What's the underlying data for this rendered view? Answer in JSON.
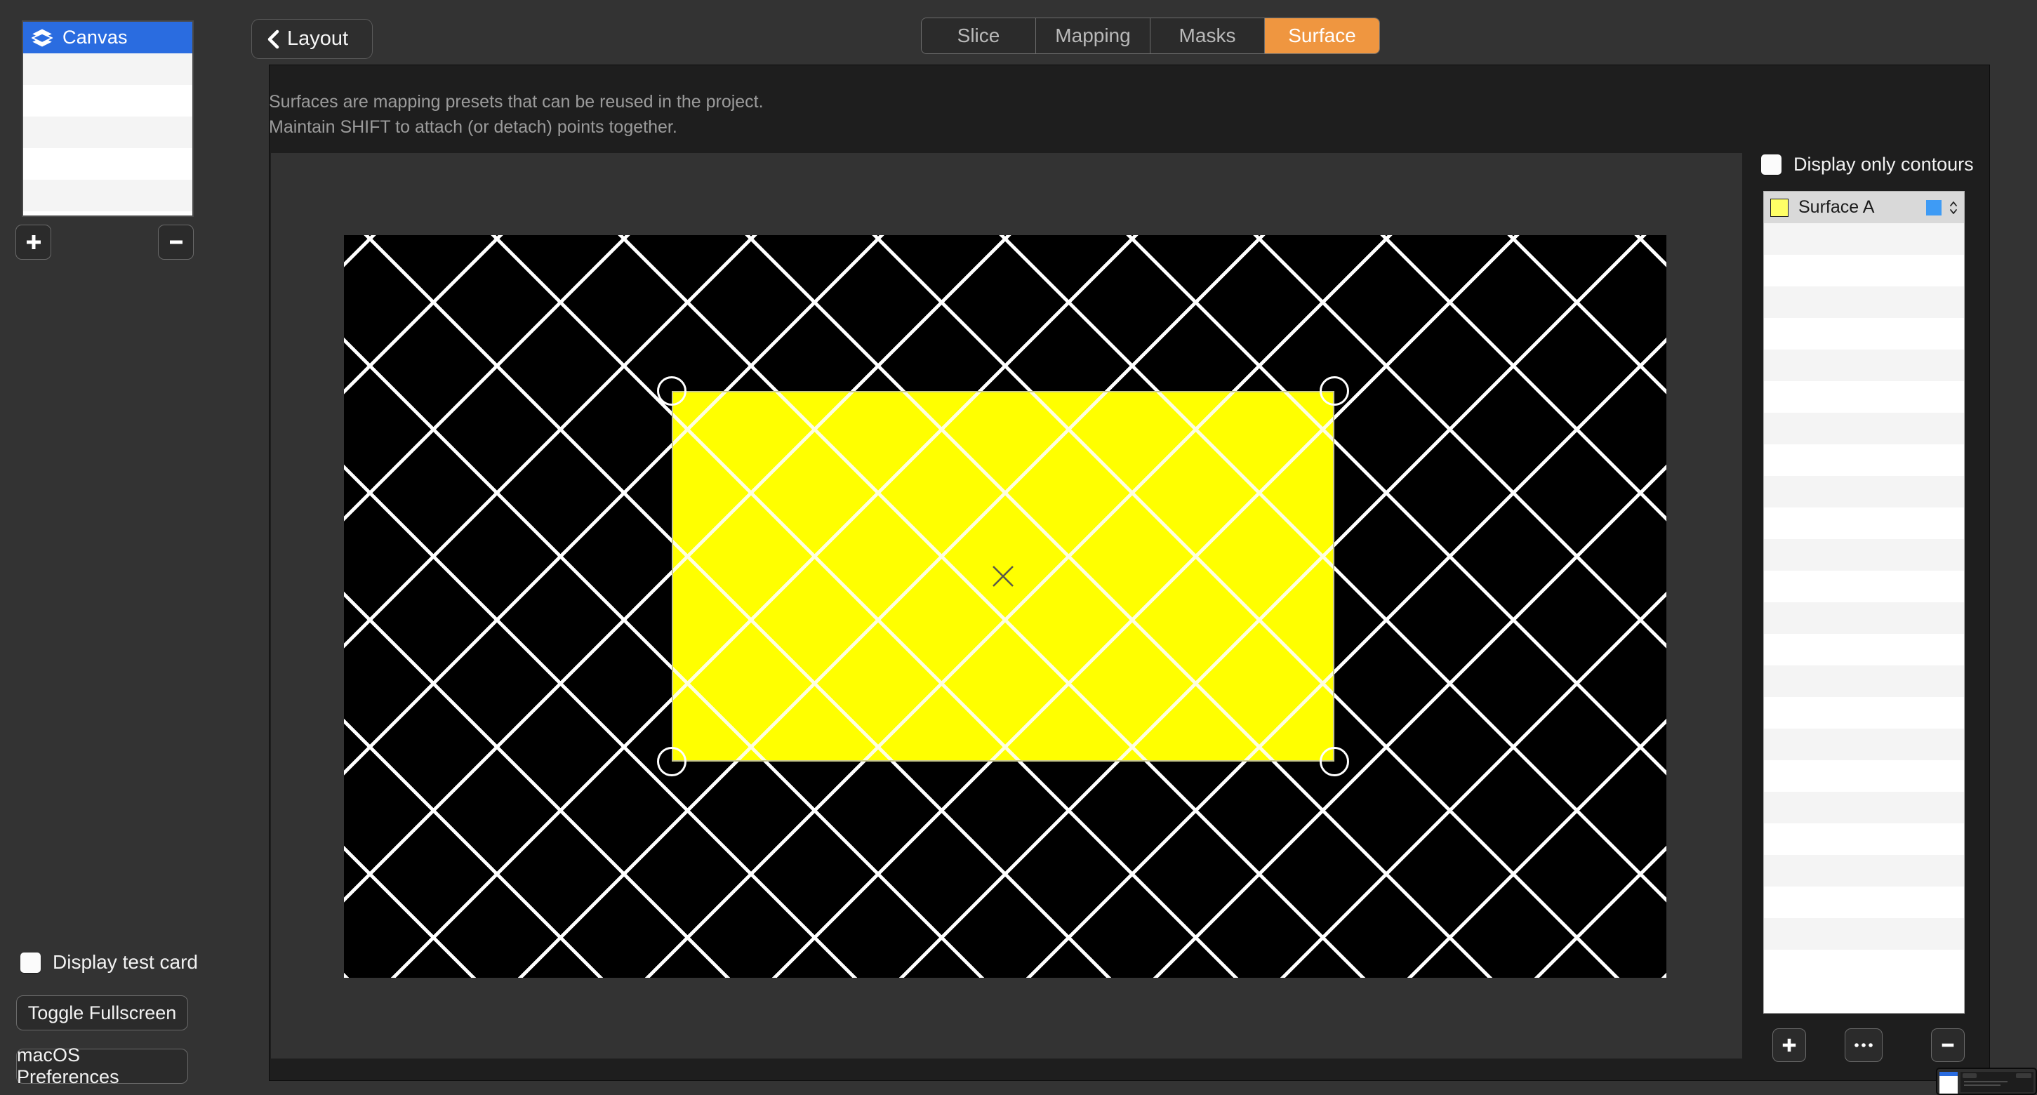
{
  "sidebar": {
    "canvas_list": {
      "selected_label": "Canvas",
      "selected_icon": "layers-icon",
      "empty_row_count": 5
    },
    "add_button_icon": "plus-icon",
    "remove_button_icon": "minus-icon",
    "display_test_card_label": "Display test card",
    "display_test_card_checked": false,
    "toggle_fullscreen_label": "Toggle Fullscreen",
    "macos_preferences_label": "macOS Preferences"
  },
  "topbar": {
    "back_icon": "chevron-left-icon",
    "layout_label": "Layout",
    "tabs": [
      {
        "label": "Slice",
        "active": false
      },
      {
        "label": "Mapping",
        "active": false
      },
      {
        "label": "Masks",
        "active": false
      },
      {
        "label": "Surface",
        "active": true
      }
    ],
    "active_tab_color": "#ef9640"
  },
  "main": {
    "description_line1": "Surfaces are mapping presets that can be reused in the project.",
    "description_line2": "Maintain SHIFT to attach (or detach) points together.",
    "stage": {
      "background_color": "#000000",
      "grid_line_color": "#ffffff",
      "surface_fill_color": "#ffff00",
      "surface_border_color": "#c9c98f",
      "center_marker_icon": "close-x-icon",
      "corner_handles": [
        "top-left",
        "top-right",
        "bottom-left",
        "bottom-right"
      ]
    }
  },
  "right_panel": {
    "display_only_contours_label": "Display only contours",
    "display_only_contours_checked": false,
    "surfaces": [
      {
        "name": "Surface A",
        "swatch_color": "#ffff66",
        "chip_color": "#3e9bf5",
        "selected": true
      }
    ],
    "empty_row_count": 24,
    "add_button_icon": "plus-icon",
    "more_button_icon": "ellipsis-icon",
    "remove_button_icon": "minus-icon"
  },
  "preview_thumbnail": {
    "name": "window-preview-thumbnail"
  }
}
